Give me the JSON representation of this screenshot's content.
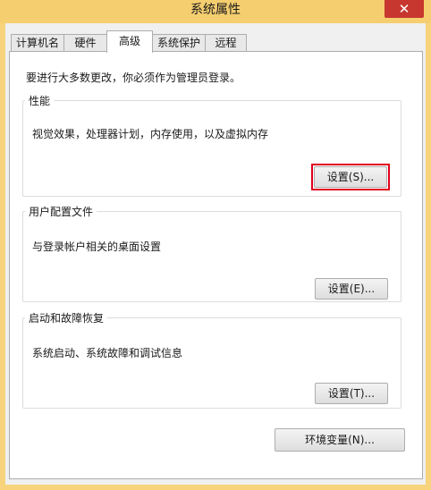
{
  "window": {
    "title": "系统属性",
    "close_glyph": "✕"
  },
  "tabs": [
    {
      "label": "计算机名",
      "active": false
    },
    {
      "label": "硬件",
      "active": false
    },
    {
      "label": "高级",
      "active": true
    },
    {
      "label": "系统保护",
      "active": false
    },
    {
      "label": "远程",
      "active": false
    }
  ],
  "advanced": {
    "admin_notice": "要进行大多数更改，你必须作为管理员登录。",
    "performance": {
      "title": "性能",
      "description": "视觉效果，处理器计划，内存使用，以及虚拟内存",
      "button": "设置(S)..."
    },
    "user_profiles": {
      "title": "用户配置文件",
      "description": "与登录帐户相关的桌面设置",
      "button": "设置(E)..."
    },
    "startup_recovery": {
      "title": "启动和故障恢复",
      "description": "系统启动、系统故障和调试信息",
      "button": "设置(T)..."
    },
    "env_button": "环境变量(N)..."
  },
  "colors": {
    "highlight": "#e0001b",
    "titlebar": "#f5ce6f",
    "close": "#c7372f"
  }
}
